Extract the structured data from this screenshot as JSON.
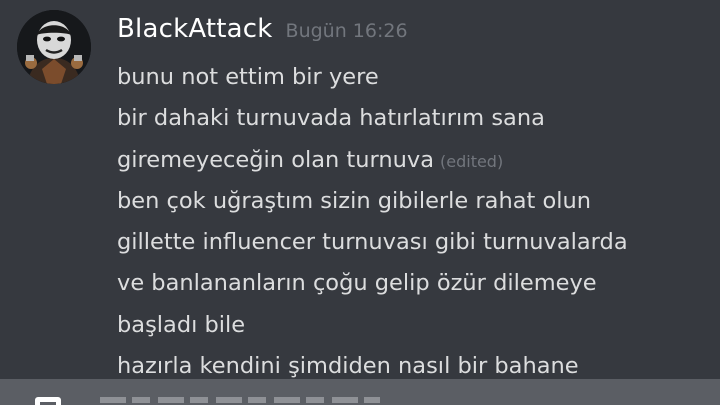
{
  "message": {
    "username": "BlackAttack",
    "timestamp": "Bugün 16:26",
    "lines": [
      "bunu not ettim bir yere",
      "bir dahaki turnuvada hatırlatırım sana",
      "giremeyeceğin olan turnuva",
      "ben çok uğraştım sizin gibilerle rahat olun",
      "gillette influencer turnuvası gibi turnuvalarda",
      "ve banlananların çoğu gelip özür dilemeye",
      "başladı bile",
      "hazırla kendini şimdiden nasıl bir bahane"
    ],
    "edited_label": "(edited)"
  },
  "colors": {
    "background": "#36393f",
    "username": "#ffffff",
    "message_text": "#dcddde",
    "muted": "#72767d",
    "composer": "#5b5e64"
  },
  "icons": {
    "avatar": "masked-user-avatar",
    "composer_attach": "attach-icon"
  }
}
